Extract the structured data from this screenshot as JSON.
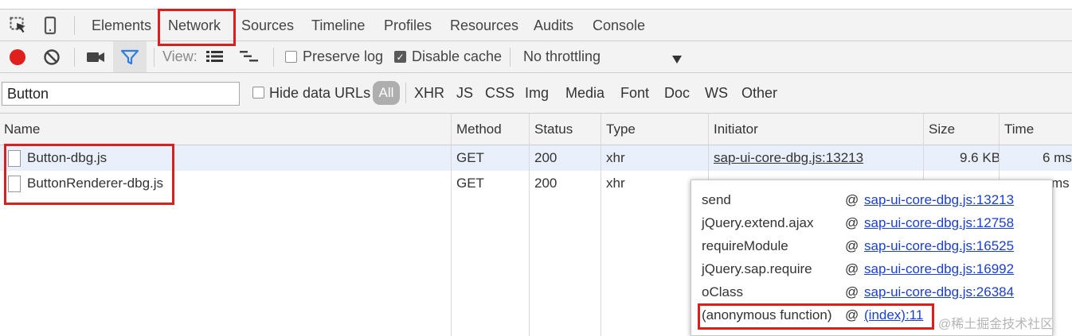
{
  "tabs": [
    "Elements",
    "Network",
    "Sources",
    "Timeline",
    "Profiles",
    "Resources",
    "Audits",
    "Console"
  ],
  "toolbar": {
    "view_label": "View:",
    "preserve_log": "Preserve log",
    "preserve_log_checked": false,
    "disable_cache": "Disable cache",
    "disable_cache_checked": true,
    "throttling": "No throttling",
    "record_color": "#e0201d",
    "filter_color": "#2f7de1"
  },
  "filter": {
    "value": "Button",
    "hide_data_urls": "Hide data URLs",
    "types": [
      "All",
      "XHR",
      "JS",
      "CSS",
      "Img",
      "Media",
      "Font",
      "Doc",
      "WS",
      "Other"
    ]
  },
  "columns": [
    "Name",
    "Method",
    "Status",
    "Type",
    "Initiator",
    "Size",
    "Time"
  ],
  "rows": [
    {
      "name": "Button-dbg.js",
      "method": "GET",
      "status": "200",
      "type": "xhr",
      "initiator": "sap-ui-core-dbg.js:13213",
      "size": "9.6 KB",
      "time": "6 ms"
    },
    {
      "name": "ButtonRenderer-dbg.js",
      "method": "GET",
      "status": "200",
      "type": "xhr",
      "initiator": "",
      "size": "",
      "time": "ms"
    }
  ],
  "stack": [
    {
      "fn": "send",
      "at": "@",
      "loc": "sap-ui-core-dbg.js:13213"
    },
    {
      "fn": "jQuery.extend.ajax",
      "at": "@",
      "loc": "sap-ui-core-dbg.js:12758"
    },
    {
      "fn": "requireModule",
      "at": "@",
      "loc": "sap-ui-core-dbg.js:16525"
    },
    {
      "fn": "jQuery.sap.require",
      "at": "@",
      "loc": "sap-ui-core-dbg.js:16992"
    },
    {
      "fn": "oClass",
      "at": "@",
      "loc": "sap-ui-core-dbg.js:26384"
    },
    {
      "fn": "(anonymous function)",
      "at": "@",
      "loc": "(index):11"
    }
  ],
  "watermark": "@稀土掘金技术社区",
  "highlight_color": "#d9201c"
}
